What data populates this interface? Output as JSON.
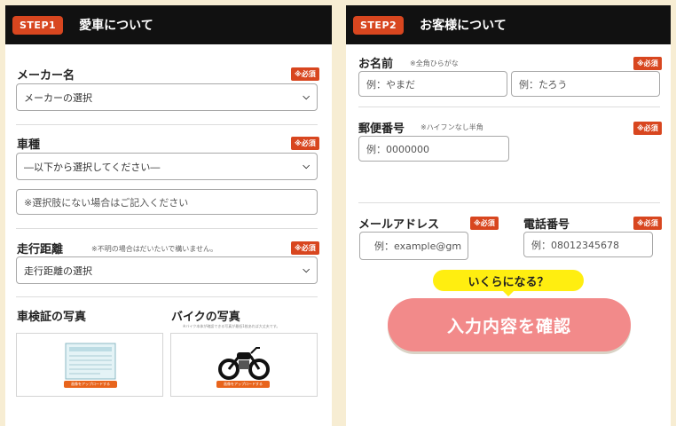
{
  "step1": {
    "badge": "STEP1",
    "title": "愛車について",
    "maker": {
      "label": "メーカー名",
      "required": "※必須",
      "value": "メーカーの選択"
    },
    "model": {
      "label": "車種",
      "required": "※必須",
      "value": "―以下から選択してください―",
      "other_placeholder": "※選択肢にない場合はご記入ください"
    },
    "mileage": {
      "label": "走行距離",
      "note": "※不明の場合はだいたいで構いません。",
      "required": "※必須",
      "value": "走行距離の選択"
    },
    "photo_cert": {
      "label": "車検証の写真",
      "upload": "画像をアップロードする"
    },
    "photo_bike": {
      "label": "バイクの写真",
      "note": "※バイク本体が確認できる写真が最低1枚あれば大丈夫です。",
      "upload": "画像をアップロードする"
    }
  },
  "step2": {
    "badge": "STEP2",
    "title": "お客様について",
    "name": {
      "label": "お名前",
      "note": "※全角ひらがな",
      "required": "※必須",
      "last_placeholder": "例：やまだ",
      "first_placeholder": "例：たろう"
    },
    "postal": {
      "label": "郵便番号",
      "note": "※ハイフンなし半角",
      "required": "※必須",
      "placeholder": "例：0000000"
    },
    "email": {
      "label": "メールアドレス",
      "required": "※必須",
      "placeholder": "例：example@gm"
    },
    "phone": {
      "label": "電話番号",
      "required": "※必須",
      "placeholder": "例：08012345678"
    },
    "bubble": "いくらになる？",
    "confirm": "入力内容を確認"
  },
  "colors": {
    "accent": "#d8461f",
    "header": "#111111",
    "background": "#f7edd3",
    "confirm": "#f28a8a",
    "bubble": "#ffee10"
  },
  "icons": [
    "chevron-down-icon",
    "vehicle-certificate-icon",
    "motorcycle-icon"
  ]
}
